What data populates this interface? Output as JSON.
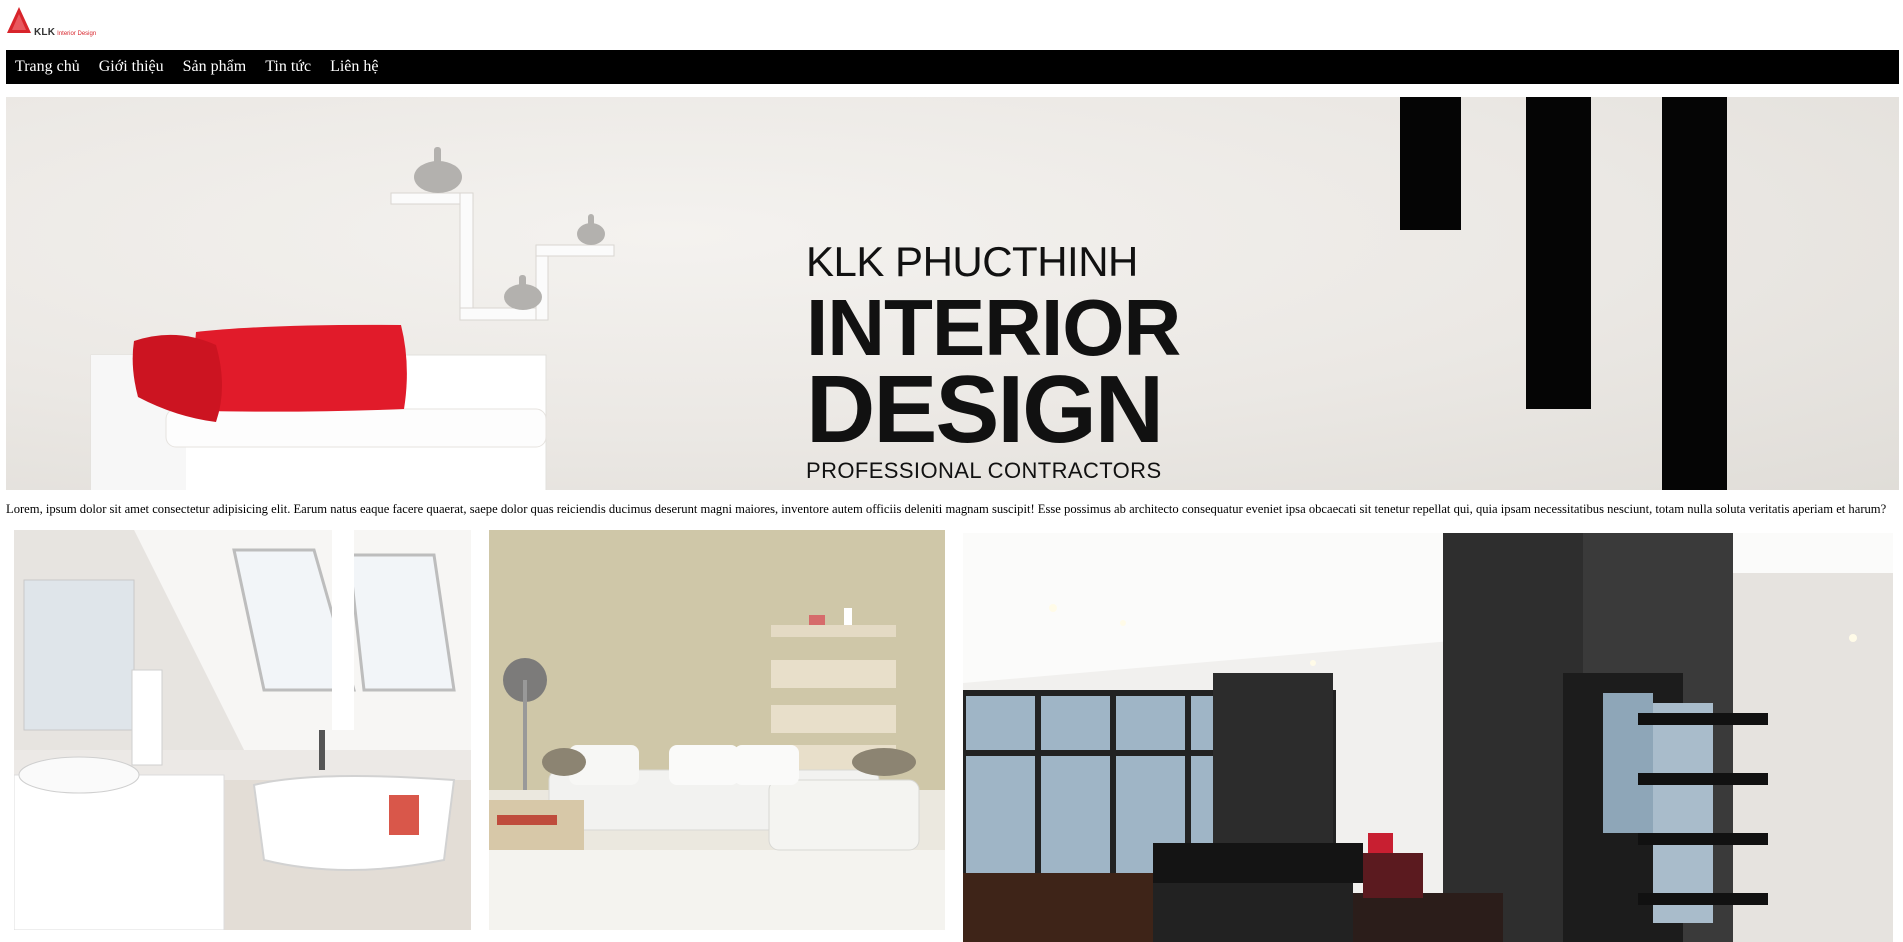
{
  "logo": {
    "brand": "KLK",
    "tagline": "Interior Design",
    "color": "#d8242b"
  },
  "nav": {
    "items": [
      {
        "label": "Trang chủ"
      },
      {
        "label": "Giới thiệu"
      },
      {
        "label": "Sản phẩm"
      },
      {
        "label": "Tin tức"
      },
      {
        "label": "Liên hệ"
      }
    ]
  },
  "banner": {
    "line1": "KLK PHUCTHINH",
    "line2": "INTERIOR",
    "line3": "DESIGN",
    "line4": "PROFESSIONAL CONTRACTORS",
    "accent_color": "#e11b2a"
  },
  "intro": {
    "text": "Lorem, ipsum dolor sit amet consectetur adipisicing elit. Earum natus eaque facere quaerat, saepe dolor quas reiciendis ducimus deserunt magni maiores, inventore autem officiis deleniti magnam suscipit! Esse possimus ab architecto consequatur eveniet ipsa obcaecati sit tenetur repellat qui, quia ipsam necessitatibus nesciunt, totam nulla soluta veritatis aperiam et harum?"
  },
  "gallery": {
    "images": [
      {
        "subject": "bathroom"
      },
      {
        "subject": "living-room"
      },
      {
        "subject": "apartment"
      }
    ]
  }
}
